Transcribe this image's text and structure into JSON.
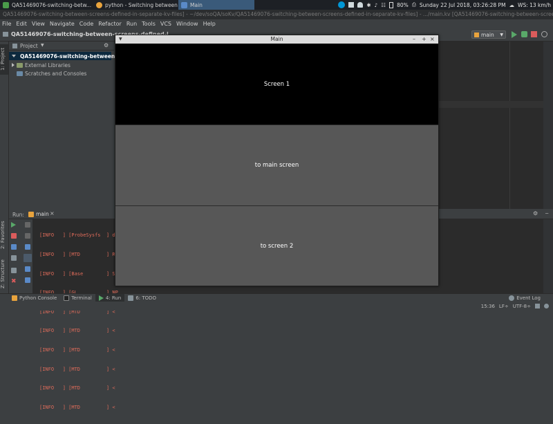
{
  "taskbar": {
    "tasks": [
      {
        "label": "QA51469076-switching-betw...",
        "color": "#4a9a4a"
      },
      {
        "label": "python - Switching between s...",
        "color": "#e8a33d"
      },
      {
        "label": "Main",
        "color": "#5a8ac8"
      }
    ],
    "tray": {
      "battery": "80%",
      "datetime": "Sunday 22 Jul 2018, 03:26:28 PM",
      "weather": "WS: 13 km/h"
    }
  },
  "ide": {
    "title": "QA51469076-switching-between-screens-defined-in-separate-kv-files] - ~/dev/soQA/soKv/QA51469076-switching-between-screens-defined-in-separate-kv-files] - .../main.kv [QA51469076-switching-between-screens-d",
    "menu": [
      "File",
      "Edit",
      "View",
      "Navigate",
      "Code",
      "Refactor",
      "Run",
      "Tools",
      "VCS",
      "Window",
      "Help"
    ],
    "breadcrumb": "QA51469076-switching-between-screens-defined-i",
    "run_config": "main"
  },
  "left_stripe": {
    "project_tab": "1: Project",
    "favorites_tab": "2: Favorites",
    "structure_tab": "Z: Structure"
  },
  "project": {
    "header": "Project",
    "tree": [
      {
        "label": "QA51469076-switching-between-screens-defined",
        "expanded": true,
        "selected": true
      },
      {
        "label": "External Libraries",
        "expanded": false,
        "selected": false
      },
      {
        "label": "Scratches and Consoles",
        "expanded": false,
        "selected": false
      }
    ]
  },
  "run": {
    "label": "Run:",
    "tab": "main",
    "log": [
      "[INFO   ] [ProbeSysfs  ] de",
      "[INFO   ] [MTD         ] Re",
      "[INFO   ] [Base        ] St",
      "[INFO   ] [GL          ] NP",
      "[INFO   ] [MTD         ] <",
      "[INFO   ] [MTD         ] <",
      "[INFO   ] [MTD         ] <",
      "[INFO   ] [MTD         ] <",
      "[INFO   ] [MTD         ] <",
      "[INFO   ] [MTD         ] <"
    ]
  },
  "bottom_tabs": [
    "Python Console",
    "Terminal",
    "4: Run",
    "6: TODO"
  ],
  "event_log": "Event Log",
  "status": {
    "position": "15:36",
    "line_sep": "LF÷",
    "encoding": "UTF-8÷"
  },
  "kivy_window": {
    "title": "Main",
    "screen_label": "Screen 1",
    "button1": "to main screen",
    "button2": "to screen 2"
  }
}
